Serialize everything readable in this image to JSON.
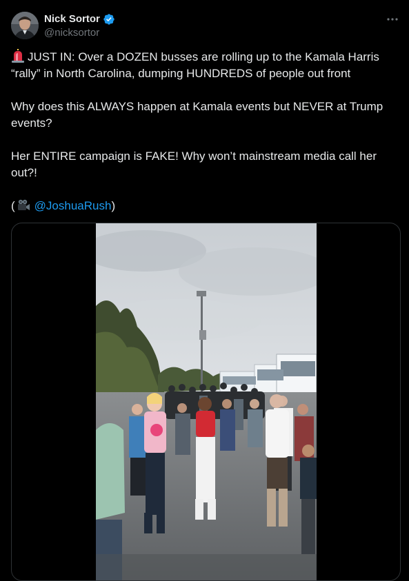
{
  "user": {
    "display_name": "Nick Sortor",
    "handle": "@nicksortor",
    "verified": true
  },
  "icons": {
    "avatar": "avatar",
    "verified": "verified-badge-icon",
    "more": "more-options-icon",
    "siren": "police-siren-emoji",
    "camera": "movie-camera-emoji"
  },
  "tweet": {
    "line1_text": "JUST IN: Over a DOZEN busses are rolling up to the Kamala Harris “rally” in North Carolina, dumping HUNDREDS of people out front",
    "line2_text": "Why does this ALWAYS happen at Kamala events but NEVER at Trump events?",
    "line3_text": "Her ENTIRE campaign is FAKE! Why won’t mainstream media call her out?!",
    "credit_open": "(",
    "credit_mention": "@JoshuaRush",
    "credit_close": ")"
  },
  "colors": {
    "background": "#000000",
    "text": "#e7e9ea",
    "secondary": "#71767b",
    "link": "#1d9bf0",
    "verified": "#1d9bf0",
    "border": "#2f3336"
  }
}
